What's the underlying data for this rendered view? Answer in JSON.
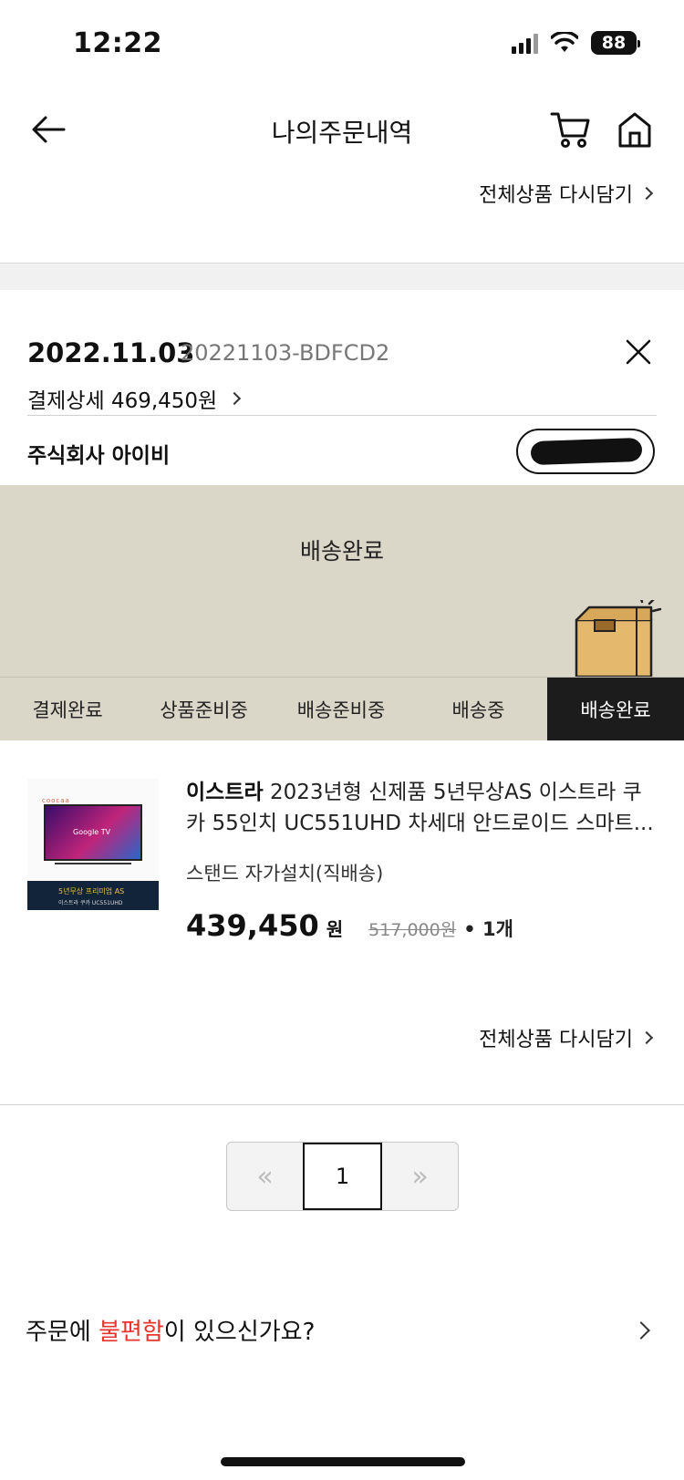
{
  "status_bar": {
    "time": "12:22",
    "battery": "88"
  },
  "header": {
    "title": "나의주문내역"
  },
  "reorder_all_label": "전체상품 다시담기",
  "order": {
    "date": "2022.11.03",
    "order_number": "20221103-BDFCD2",
    "payment_detail_label": "결제상세 469,450원",
    "seller": "주식회사 아이비"
  },
  "delivery": {
    "status_title": "배송완료",
    "steps": [
      {
        "label": "결제완료",
        "active": false
      },
      {
        "label": "상품준비중",
        "active": false
      },
      {
        "label": "배송준비중",
        "active": false
      },
      {
        "label": "배송중",
        "active": false
      },
      {
        "label": "배송완료",
        "active": true
      }
    ]
  },
  "product": {
    "brand": "이스트라",
    "name": "2023년형 신제품 5년무상AS 이스트라 쿠카 55인치 UC551UHD 차세대 안드로이드 스마트...",
    "option": "스탠드 자가설치(직배송)",
    "price": "439,450",
    "currency": "원",
    "original_price": "517,000원",
    "quantity": "• 1개",
    "thumb_brand": "coocaa",
    "thumb_screen": "Google TV",
    "thumb_banner": "5년무상 프리미엄 AS",
    "thumb_banner_sub": "이스트라 쿠카 UC551UHD"
  },
  "pagination": {
    "prev": "«",
    "current": "1",
    "next": "»"
  },
  "issue": {
    "prefix": "주문에 ",
    "highlight": "불편함",
    "suffix": "이 있으신가요?"
  },
  "colors": {
    "accent_red": "#e8332c",
    "delivery_bg": "#dad6c8",
    "active_step": "#1c1c1c"
  }
}
